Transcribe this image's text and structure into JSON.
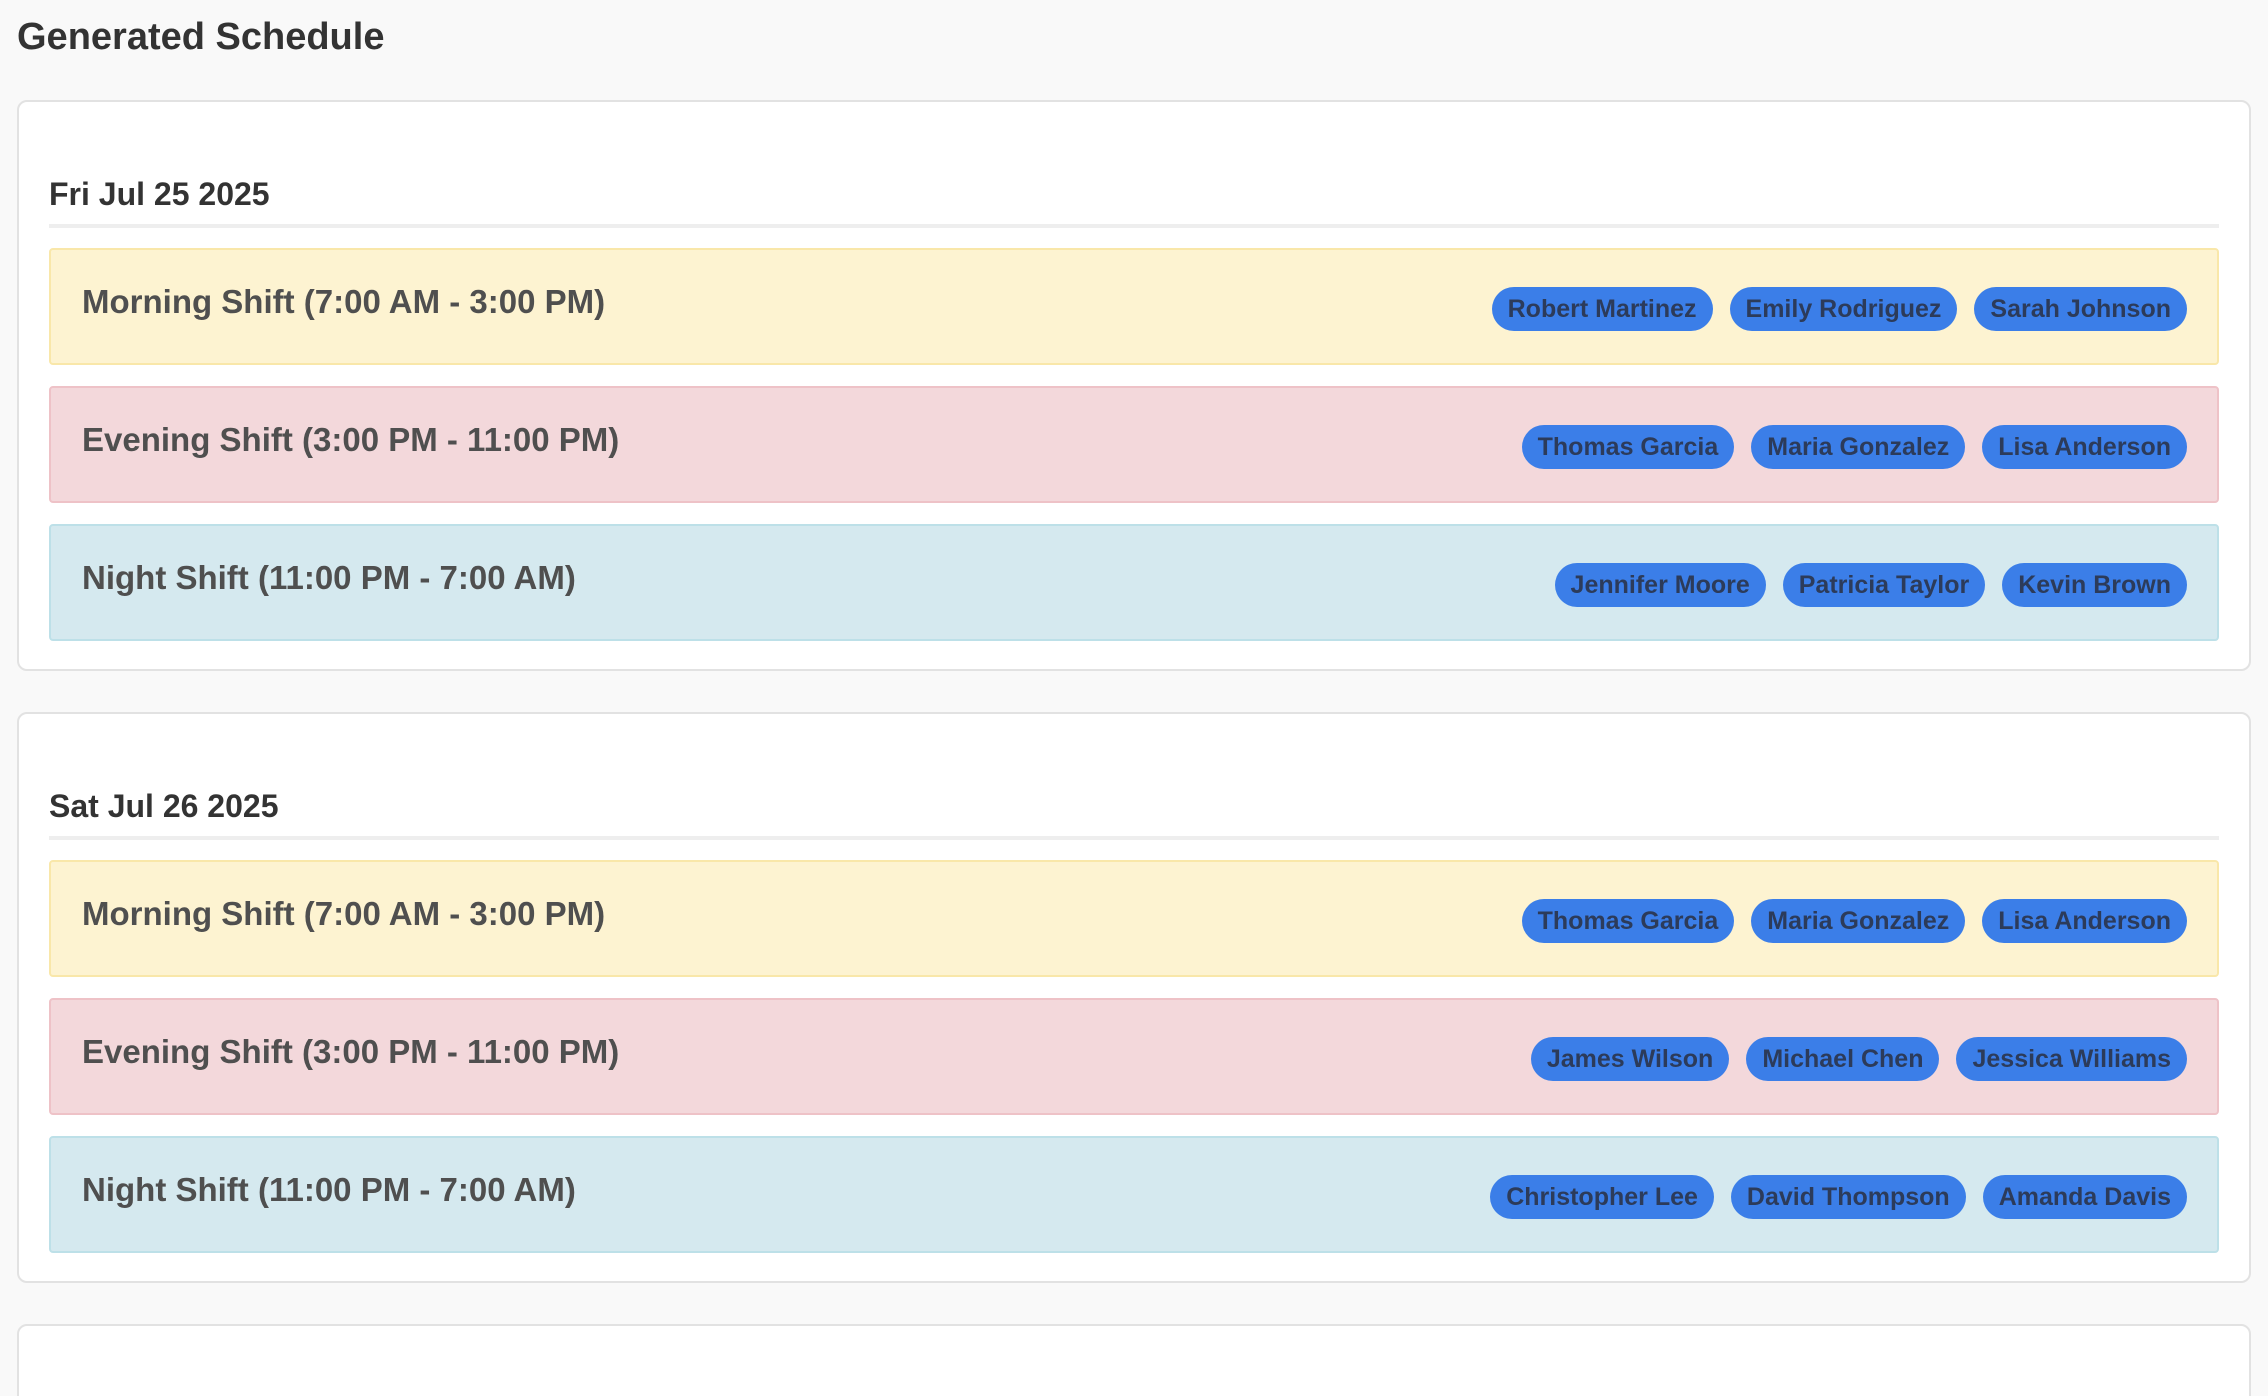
{
  "page": {
    "title": "Generated Schedule"
  },
  "days": [
    {
      "date": "Fri Jul 25 2025",
      "shifts": [
        {
          "type": "morning",
          "label": "Morning Shift (7:00 AM - 3:00 PM)",
          "staff": [
            "Robert Martinez",
            "Emily Rodriguez",
            "Sarah Johnson"
          ]
        },
        {
          "type": "evening",
          "label": "Evening Shift (3:00 PM - 11:00 PM)",
          "staff": [
            "Thomas Garcia",
            "Maria Gonzalez",
            "Lisa Anderson"
          ]
        },
        {
          "type": "night",
          "label": "Night Shift (11:00 PM - 7:00 AM)",
          "staff": [
            "Jennifer Moore",
            "Patricia Taylor",
            "Kevin Brown"
          ]
        }
      ]
    },
    {
      "date": "Sat Jul 26 2025",
      "shifts": [
        {
          "type": "morning",
          "label": "Morning Shift (7:00 AM - 3:00 PM)",
          "staff": [
            "Thomas Garcia",
            "Maria Gonzalez",
            "Lisa Anderson"
          ]
        },
        {
          "type": "evening",
          "label": "Evening Shift (3:00 PM - 11:00 PM)",
          "staff": [
            "James Wilson",
            "Michael Chen",
            "Jessica Williams"
          ]
        },
        {
          "type": "night",
          "label": "Night Shift (11:00 PM - 7:00 AM)",
          "staff": [
            "Christopher Lee",
            "David Thompson",
            "Amanda Davis"
          ]
        }
      ]
    }
  ],
  "colors": {
    "page_background": "#f9f9f9",
    "card_background": "#ffffff",
    "morning": "#fdf3d1",
    "evening": "#f3d8db",
    "night": "#d5e9ef",
    "staff_pill": "#3b7ee8",
    "staff_pill_text": "#2c3b5a"
  }
}
